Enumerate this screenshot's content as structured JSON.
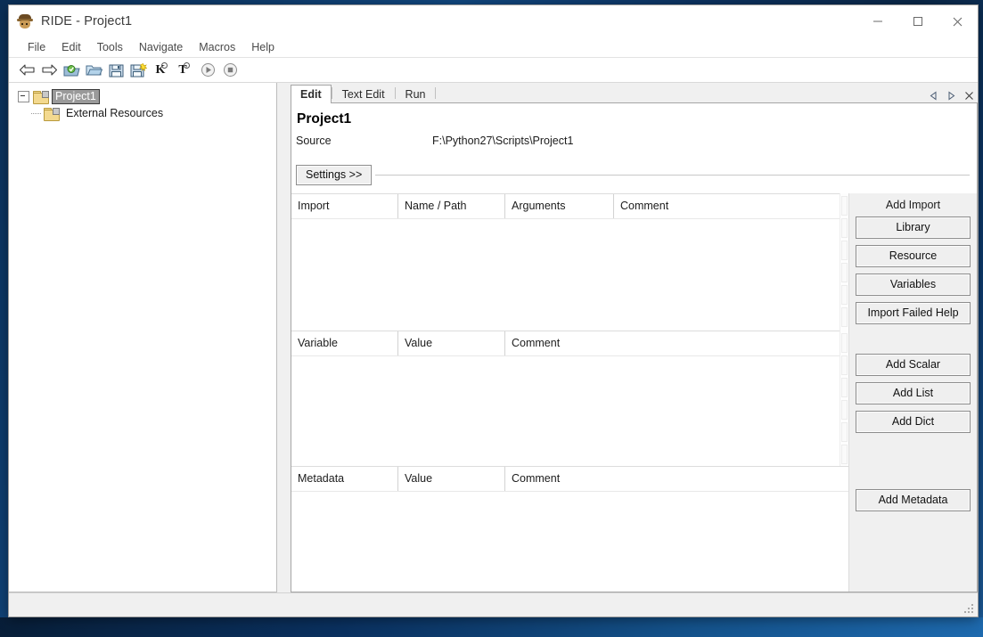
{
  "window": {
    "title": "RIDE - Project1",
    "app_icon": "ride-app-icon",
    "controls": {
      "minimize": "minimize-icon",
      "maximize": "maximize-icon",
      "close": "close-icon"
    }
  },
  "menubar": {
    "items": [
      {
        "label": "File"
      },
      {
        "label": "Edit"
      },
      {
        "label": "Tools"
      },
      {
        "label": "Navigate"
      },
      {
        "label": "Macros"
      },
      {
        "label": "Help"
      }
    ]
  },
  "toolbar": {
    "items": [
      {
        "name": "back-arrow-icon"
      },
      {
        "name": "forward-arrow-icon"
      },
      {
        "name": "open-project-icon"
      },
      {
        "name": "open-folder-icon"
      },
      {
        "name": "save-icon"
      },
      {
        "name": "save-all-icon"
      },
      {
        "name": "search-keyword-icon",
        "letter": "K"
      },
      {
        "name": "search-test-icon",
        "letter": "T"
      },
      {
        "name": "run-icon"
      },
      {
        "name": "stop-icon"
      }
    ]
  },
  "tree": {
    "nodes": [
      {
        "label": "Project1",
        "icon": "project-folder-icon",
        "selected": true,
        "expanded": true
      },
      {
        "label": "External Resources",
        "icon": "resource-folder-icon",
        "selected": false,
        "expanded": false
      }
    ]
  },
  "tabs": {
    "items": [
      {
        "label": "Edit",
        "active": true
      },
      {
        "label": "Text Edit",
        "active": false
      },
      {
        "label": "Run",
        "active": false
      }
    ],
    "nav": {
      "prev": "prev-tab-icon",
      "next": "next-tab-icon",
      "close": "close-tab-icon"
    }
  },
  "settings": {
    "title": "Project1",
    "source_label": "Source",
    "source_value": "F:\\Python27\\Scripts\\Project1",
    "settings_button": "Settings >>"
  },
  "import_grid": {
    "columns": [
      "Import",
      "Name / Path",
      "Arguments",
      "Comment"
    ],
    "rows": [],
    "side": {
      "title": "Add Import",
      "buttons": [
        "Library",
        "Resource",
        "Variables",
        "Import Failed Help"
      ]
    }
  },
  "variable_grid": {
    "columns": [
      "Variable",
      "Value",
      "Comment"
    ],
    "rows": [],
    "side": {
      "title": "",
      "buttons": [
        "Add Scalar",
        "Add List",
        "Add Dict"
      ]
    }
  },
  "metadata_grid": {
    "columns": [
      "Metadata",
      "Value",
      "Comment"
    ],
    "rows": [],
    "side": {
      "title": "",
      "buttons": [
        "Add Metadata"
      ]
    }
  },
  "statusbar": {
    "text": ""
  },
  "colors": {
    "desktop": "#0e3b6b",
    "window_bg": "#ffffff",
    "panel_bg": "#f0f0f0",
    "selection": "#9a9a9a",
    "border": "#a6a6a6",
    "folder": "#f3d98f"
  }
}
